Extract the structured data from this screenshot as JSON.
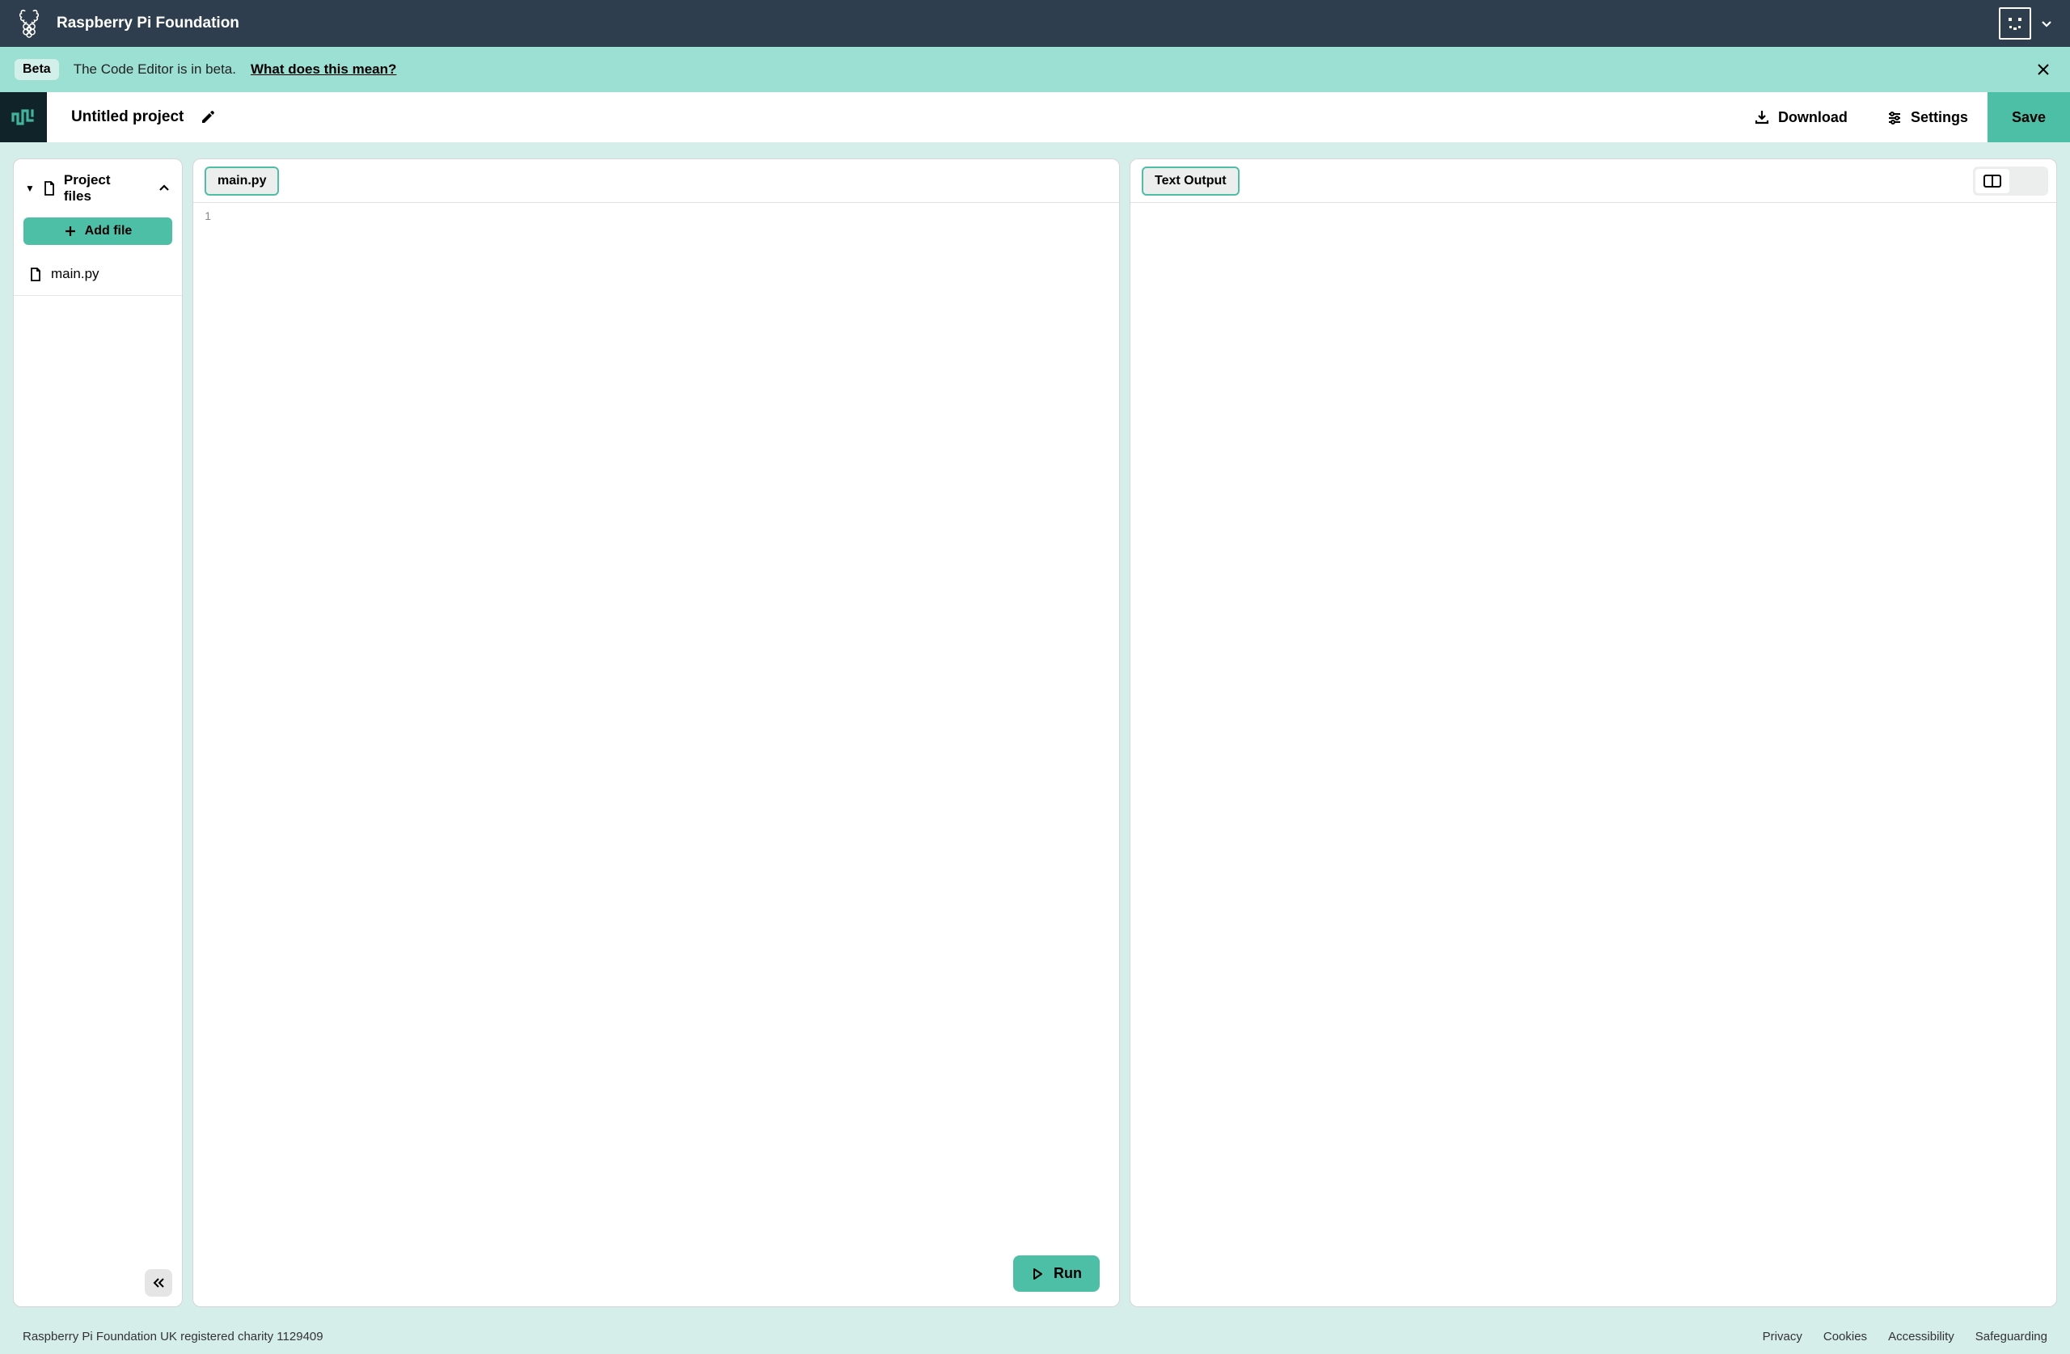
{
  "header": {
    "org_name": "Raspberry Pi Foundation"
  },
  "beta_banner": {
    "badge": "Beta",
    "text": "The Code Editor is in beta.",
    "link": "What does this mean?"
  },
  "project_bar": {
    "title": "Untitled project",
    "download": "Download",
    "settings": "Settings",
    "save": "Save"
  },
  "sidebar": {
    "heading": "Project files",
    "add_file": "Add file",
    "files": [
      {
        "name": "main.py"
      }
    ]
  },
  "editor": {
    "tab": "main.py",
    "line_number": "1",
    "run": "Run"
  },
  "output": {
    "tab": "Text Output"
  },
  "footer": {
    "charity": "Raspberry Pi Foundation UK registered charity 1129409",
    "links": [
      "Privacy",
      "Cookies",
      "Accessibility",
      "Safeguarding"
    ]
  }
}
